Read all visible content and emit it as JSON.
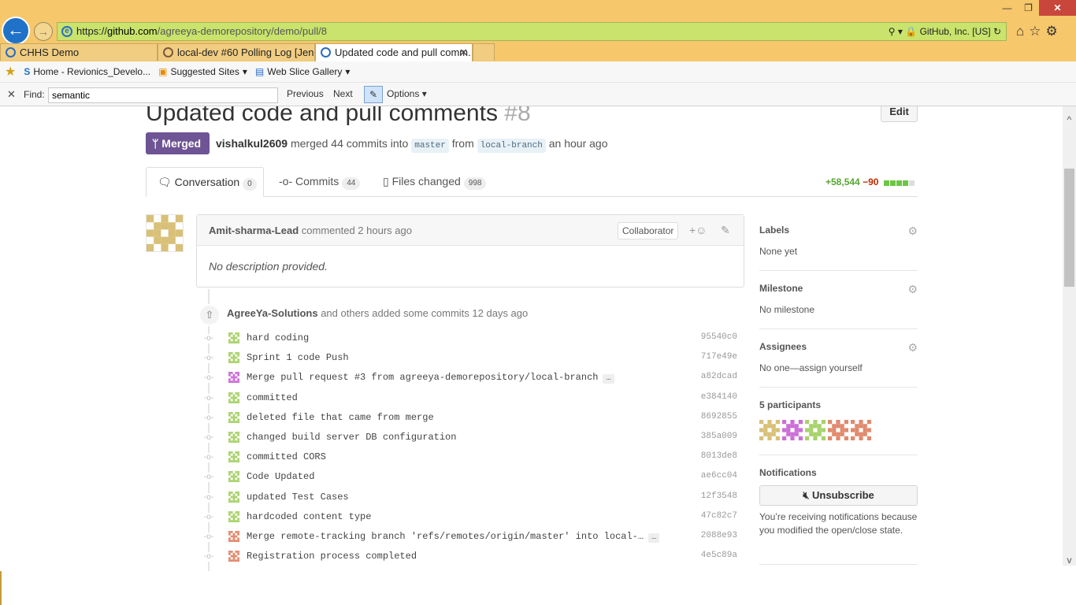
{
  "browser": {
    "url_scheme": "https://",
    "url_host": "github.com",
    "url_path": "/agreeya-demorepository/demo/pull/8",
    "site_identity": "GitHub, Inc. [US]",
    "tabs": [
      {
        "label": "CHHS Demo"
      },
      {
        "label": "local-dev #60 Polling Log [Jen..."
      },
      {
        "label": "Updated code and pull comm..."
      }
    ],
    "favorites": [
      {
        "label": "Home - Revionics_Develo..."
      },
      {
        "label": "Suggested Sites"
      },
      {
        "label": "Web Slice Gallery"
      }
    ],
    "find": {
      "label": "Find:",
      "value": "semantic",
      "previous": "Previous",
      "next": "Next",
      "options": "Options"
    }
  },
  "pr": {
    "title": "Updated code and pull comments",
    "number": "#8",
    "edit_label": "Edit",
    "state": "Merged",
    "merger": "vishalkul2609",
    "merged_text": "merged 44 commits into",
    "base_branch": "master",
    "from_text": "from",
    "head_branch": "local-branch",
    "time": "an hour ago",
    "tabs": [
      {
        "label": "Conversation",
        "count": "0"
      },
      {
        "label": "Commits",
        "count": "44"
      },
      {
        "label": "Files changed",
        "count": "998"
      }
    ],
    "additions": "+58,544",
    "deletions": "−90",
    "diff_blocks": [
      1,
      1,
      1,
      1,
      0
    ]
  },
  "comment": {
    "author": "Amit-sharma-Lead",
    "action": "commented 2 hours ago",
    "badge": "Collaborator",
    "body": "No description provided."
  },
  "commits_group": {
    "author": "AgreeYa-Solutions",
    "text": "and others added some commits 12 days ago"
  },
  "commits": [
    {
      "msg": "hard coding",
      "sha": "95540c0",
      "avatar": "green",
      "ellipsis": ""
    },
    {
      "msg": "Sprint 1 code Push",
      "sha": "717e49e",
      "avatar": "green",
      "ellipsis": ""
    },
    {
      "msg": "Merge pull request #3 from agreeya-demorepository/local-branch",
      "sha": "a82dcad",
      "avatar": "purple",
      "ellipsis": "…"
    },
    {
      "msg": "committed",
      "sha": "e384140",
      "avatar": "green",
      "ellipsis": ""
    },
    {
      "msg": "deleted file that came from merge",
      "sha": "8692855",
      "avatar": "green",
      "ellipsis": ""
    },
    {
      "msg": "changed build server DB configuration",
      "sha": "385a009",
      "avatar": "green",
      "ellipsis": ""
    },
    {
      "msg": "committed CORS",
      "sha": "8013de8",
      "avatar": "green",
      "ellipsis": ""
    },
    {
      "msg": "Code Updated",
      "sha": "ae6cc04",
      "avatar": "green",
      "ellipsis": ""
    },
    {
      "msg": "updated Test Cases",
      "sha": "12f3548",
      "avatar": "green",
      "ellipsis": ""
    },
    {
      "msg": "hardcoded content type",
      "sha": "47c82c7",
      "avatar": "green",
      "ellipsis": ""
    },
    {
      "msg": "Merge remote-tracking branch 'refs/remotes/origin/master' into local-…",
      "sha": "2088e93",
      "avatar": "salmon",
      "ellipsis": "…"
    },
    {
      "msg": "Registration process completed",
      "sha": "4e5c89a",
      "avatar": "salmon",
      "ellipsis": ""
    }
  ],
  "sidebar": {
    "labels_title": "Labels",
    "labels_value": "None yet",
    "milestone_title": "Milestone",
    "milestone_value": "No milestone",
    "assignees_title": "Assignees",
    "assignees_value": "No one—assign yourself",
    "participants_title": "5 participants",
    "participants": [
      "tan",
      "purple",
      "green",
      "salmon",
      "salmon"
    ],
    "notifications_title": "Notifications",
    "unsubscribe_label": "Unsubscribe",
    "notifications_text": "You’re receiving notifications because you modified the open/close state."
  },
  "colors": {
    "merged": "#6e5494",
    "additions": "#55a532",
    "deletions": "#bd2c00",
    "tan": "#d8c078",
    "green": "#a9d26c",
    "purple": "#cc6ed8",
    "salmon": "#e08a6e"
  }
}
